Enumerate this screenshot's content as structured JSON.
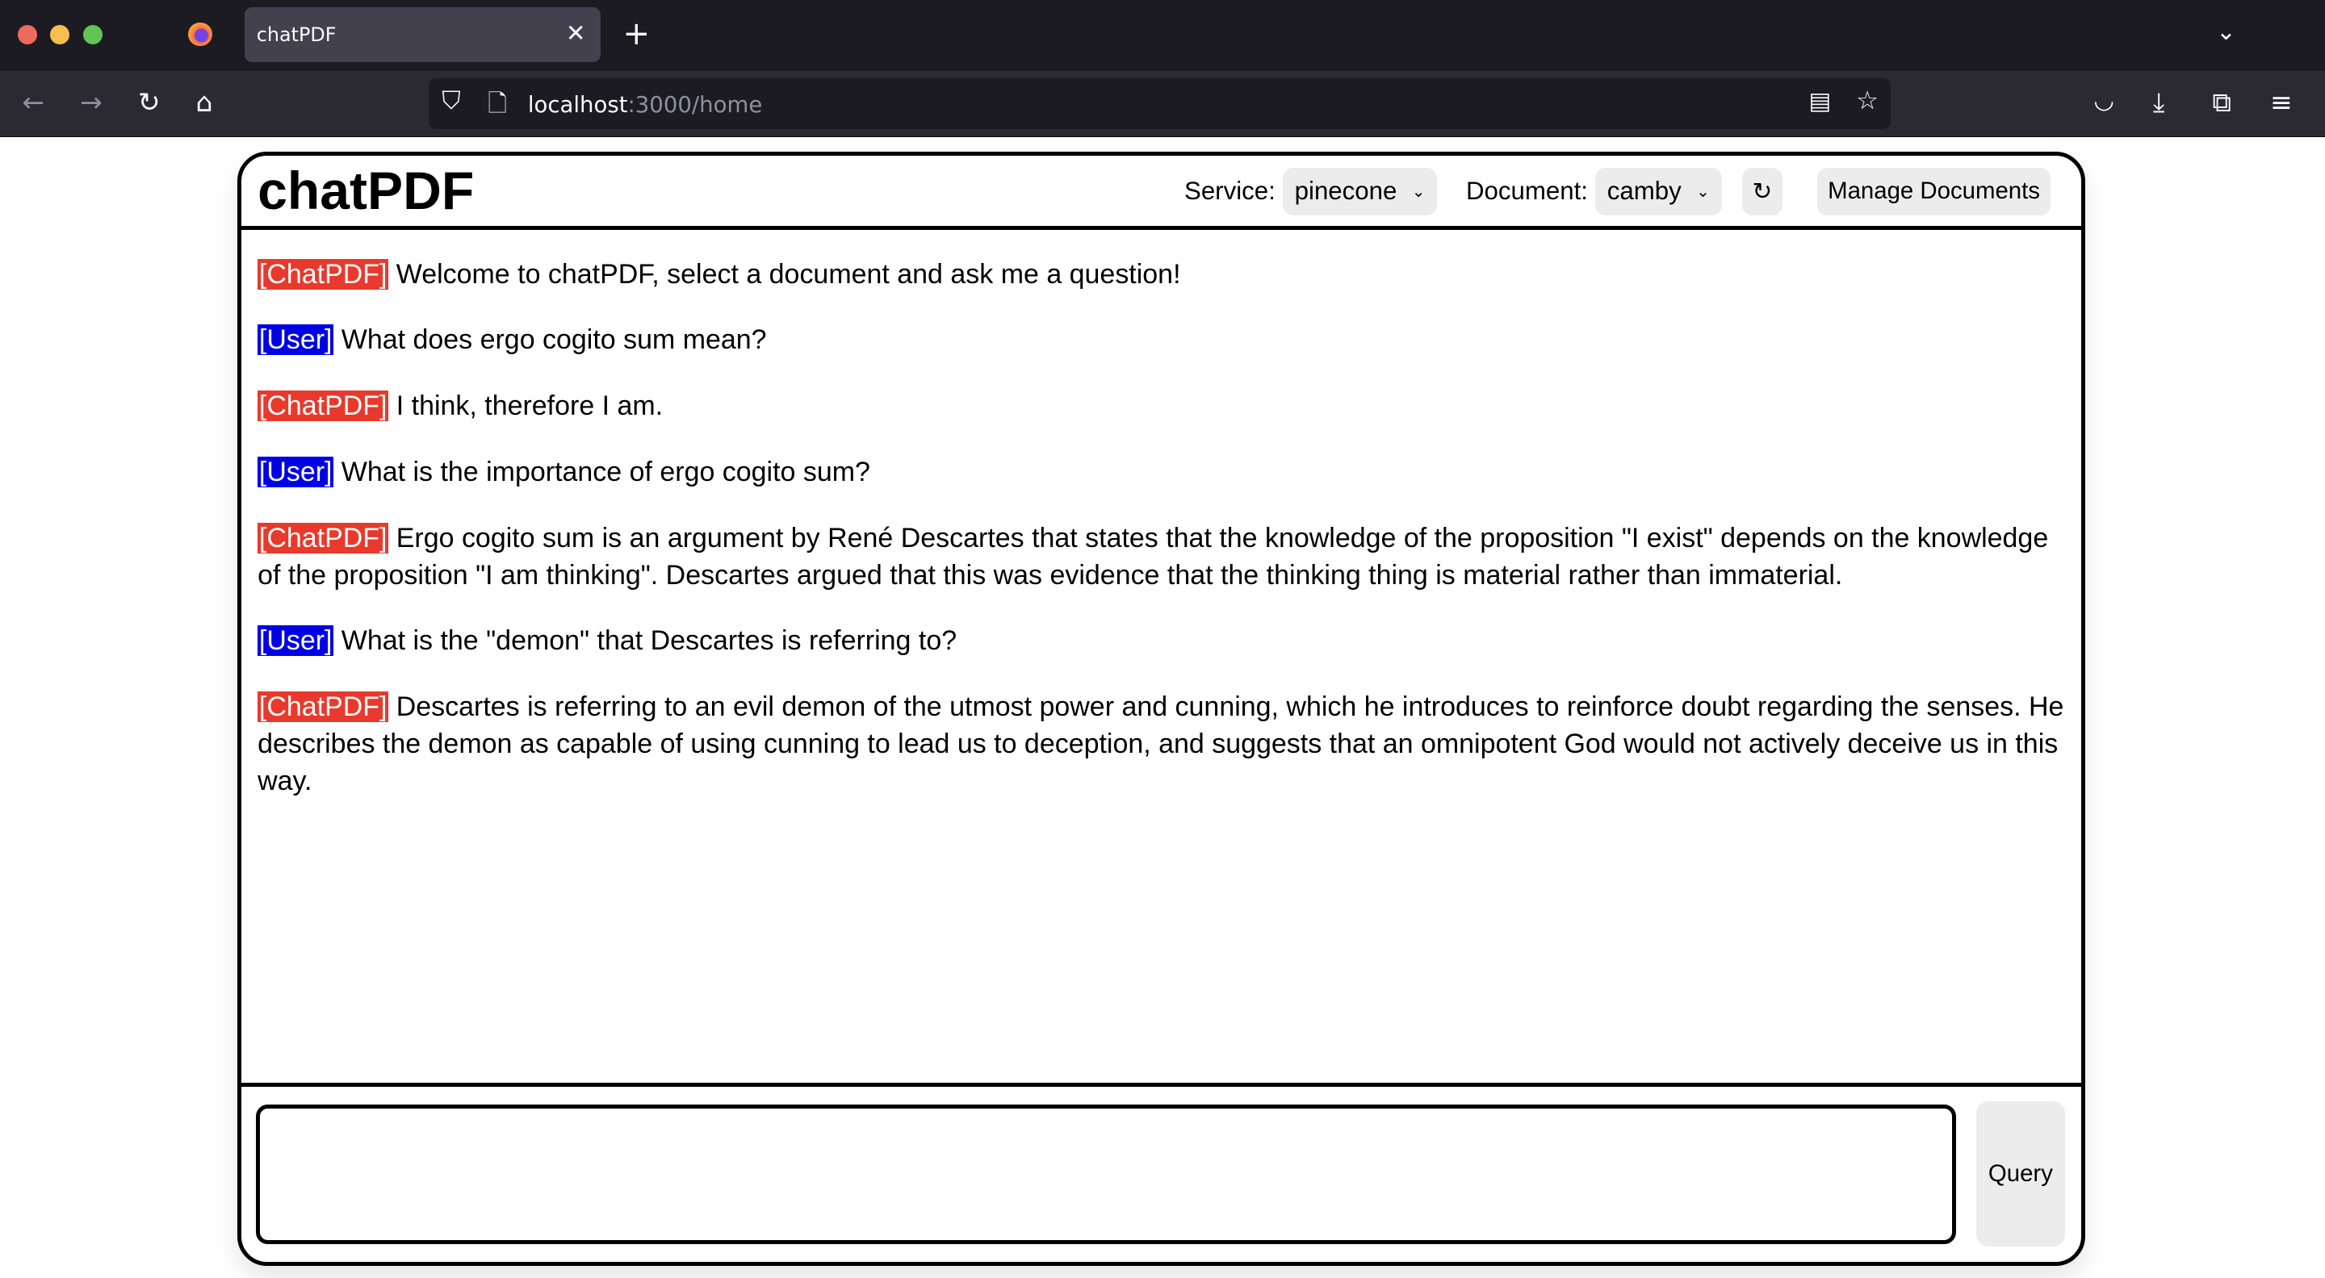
{
  "browser": {
    "tab_title": "chatPDF",
    "url_host": "localhost",
    "url_path": ":3000/home"
  },
  "app": {
    "title": "chatPDF",
    "service_label": "Service:",
    "service_value": "pinecone",
    "document_label": "Document:",
    "document_value": "camby",
    "manage_label": "Manage Documents",
    "query_label": "Query",
    "input_value": ""
  },
  "messages": [
    {
      "role": "bot",
      "tag": "[ChatPDF]",
      "text": "Welcome to chatPDF, select a document and ask me a question!"
    },
    {
      "role": "user",
      "tag": "[User]",
      "text": "What does ergo cogito sum mean?"
    },
    {
      "role": "bot",
      "tag": "[ChatPDF]",
      "text": "I think, therefore I am."
    },
    {
      "role": "user",
      "tag": "[User]",
      "text": "What is the importance of ergo cogito sum?"
    },
    {
      "role": "bot",
      "tag": "[ChatPDF]",
      "text": "Ergo cogito sum is an argument by René Descartes that states that the knowledge of the proposition \"I exist\" depends on the knowledge of the proposition \"I am thinking\". Descartes argued that this was evidence that the thinking thing is material rather than immaterial."
    },
    {
      "role": "user",
      "tag": "[User]",
      "text": "What is the \"demon\" that Descartes is referring to?"
    },
    {
      "role": "bot",
      "tag": "[ChatPDF]",
      "text": "Descartes is referring to an evil demon of the utmost power and cunning, which he introduces to reinforce doubt regarding the senses. He describes the demon as capable of using cunning to lead us to deception, and suggests that an omnipotent God would not actively deceive us in this way."
    }
  ],
  "colors": {
    "bot_tag": "#e8392c",
    "user_tag": "#0000e6"
  }
}
